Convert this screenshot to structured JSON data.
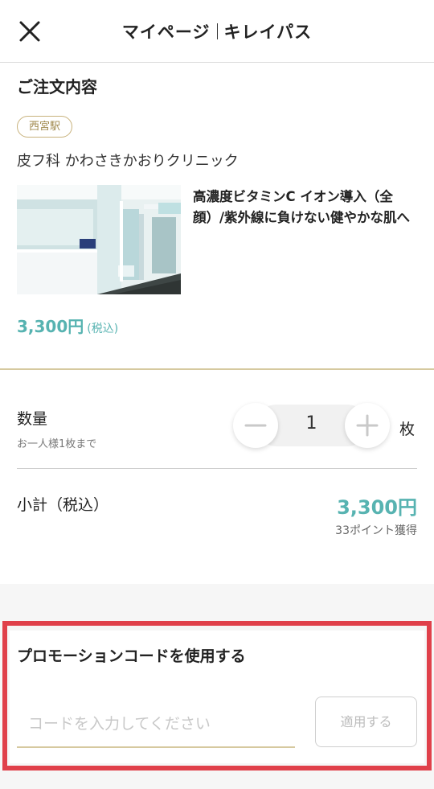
{
  "header": {
    "title_left": "マイページ",
    "title_right": "キレイパス"
  },
  "order": {
    "section_title": "ご注文内容",
    "station_badge": "西宮駅",
    "clinic_name": "皮フ科 かわさきかおりクリニック",
    "product_name": "高濃度ビタミンC イオン導入（全顔）/紫外線に負けない健やかな肌へ",
    "price": "3,300円",
    "price_tax": "(税込)"
  },
  "quantity": {
    "label": "数量",
    "note": "お一人様1枚まで",
    "value": "1",
    "unit": "枚",
    "minus_symbol": "−",
    "plus_symbol": "＋"
  },
  "subtotal": {
    "label": "小計（税込）",
    "value": "3,300円",
    "points": "33ポイント獲得"
  },
  "promo": {
    "title": "プロモーションコードを使用する",
    "placeholder": "コードを入力してください",
    "apply_label": "適用する"
  },
  "colors": {
    "accent_teal": "#57b3b1",
    "gold": "#d6c99f",
    "highlight_red": "#e0404a"
  }
}
